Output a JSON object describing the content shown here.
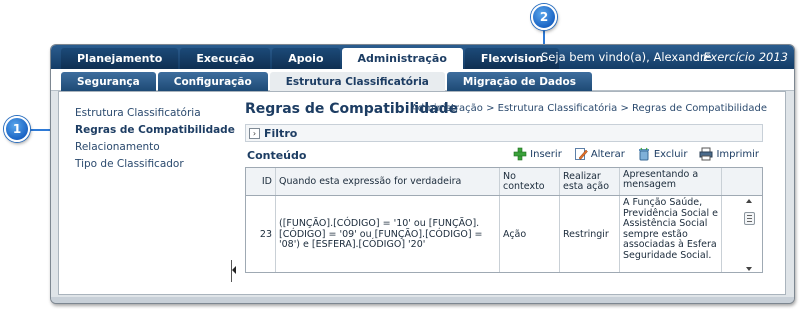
{
  "callouts": {
    "one": "1",
    "two": "2"
  },
  "topbar": {
    "tabs": [
      {
        "label": "Planejamento"
      },
      {
        "label": "Execução"
      },
      {
        "label": "Apoio"
      },
      {
        "label": "Administração"
      },
      {
        "label": "Flexvision"
      }
    ],
    "welcome": "Seja bem vindo(a), Alexandre",
    "exercicio": "Exercício 2013"
  },
  "subtabs": [
    {
      "label": "Segurança"
    },
    {
      "label": "Configuração"
    },
    {
      "label": "Estrutura Classificatória"
    },
    {
      "label": "Migração de Dados"
    }
  ],
  "sidebar": {
    "items": [
      {
        "label": "Estrutura Classificatória"
      },
      {
        "label": "Regras de Compatibilidade"
      },
      {
        "label": "Relacionamento"
      },
      {
        "label": "Tipo de Classificador"
      }
    ]
  },
  "panel": {
    "title": "Regras de Compatibilidade",
    "breadcrumb": "Administração > Estrutura Classificatória > Regras de Compatibilidade",
    "filter_label": "Filtro",
    "content_label": "Conteúdo"
  },
  "toolbar": {
    "insert": "Inserir",
    "edit": "Alterar",
    "delete": "Excluir",
    "print": "Imprimir"
  },
  "grid": {
    "headers": {
      "id": "ID",
      "expr": "Quando esta expressão for verdadeira",
      "ctx": "No contexto",
      "act": "Realizar esta ação",
      "msg": "Apresentando a mensagem"
    },
    "rows": [
      {
        "id": "23",
        "expr": "([FUNÇÃO].[CÓDIGO] = '10' ou [FUNÇÃO].[CÓDIGO] = '09' ou [FUNÇÃO].[CÓDIGO] = '08') e [ESFERA].[CÓDIGO] '20'",
        "ctx": "Ação",
        "act": "Restringir",
        "msg": "A Função Saúde, Previdência Social e Assistência Social sempre estão associadas à Esfera Seguridade Social."
      }
    ]
  },
  "colors": {
    "header_bg": "#143c66",
    "accent": "#1d3d63",
    "callout": "#1b64c4"
  }
}
